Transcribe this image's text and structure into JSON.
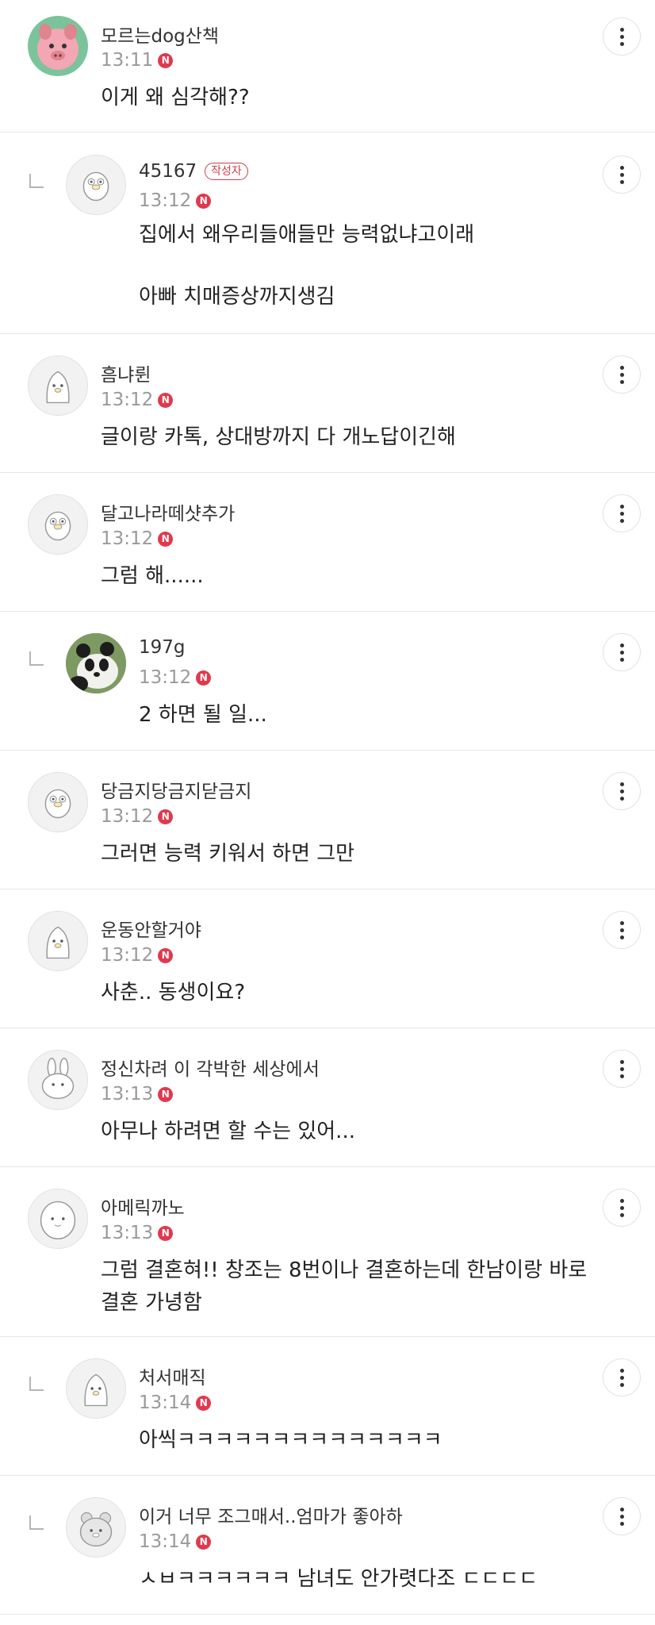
{
  "comments": [
    {
      "nick": "모르는dog산책",
      "time": "13:11",
      "badge": "N",
      "lines": [
        "이게 왜 심각해??"
      ]
    },
    {
      "nick": "45167",
      "author_badge": "작성자",
      "time": "13:12",
      "badge": "N",
      "lines": [
        "집에서 왜우리들애들만 능력없냐고이래",
        "",
        "아빠 치매증상까지생김"
      ]
    },
    {
      "nick": "흠냐륀",
      "time": "13:12",
      "badge": "N",
      "lines": [
        "글이랑 카톡, 상대방까지 다 개노답이긴해"
      ]
    },
    {
      "nick": "달고나라떼샷추가",
      "time": "13:12",
      "badge": "N",
      "lines": [
        "그럼 해......"
      ]
    },
    {
      "nick": "197g",
      "time": "13:12",
      "badge": "N",
      "lines": [
        "2 하면 될 일..."
      ]
    },
    {
      "nick": "당금지당금지닫금지",
      "time": "13:12",
      "badge": "N",
      "lines": [
        "그러면 능력 키워서 하면 그만"
      ]
    },
    {
      "nick": "운동안할거야",
      "time": "13:12",
      "badge": "N",
      "lines": [
        "사춘.. 동생이요?"
      ]
    },
    {
      "nick": "정신차려 이 각박한 세상에서",
      "time": "13:13",
      "badge": "N",
      "lines": [
        "아무나 하려면 할 수는 있어..."
      ]
    },
    {
      "nick": "아메릭까노",
      "time": "13:13",
      "badge": "N",
      "lines": [
        "그럼 결혼혀!! 창조는 8번이나 결혼하는데 한남이랑 바로",
        "결혼 가녕함"
      ]
    },
    {
      "nick": "처서매직",
      "time": "13:14",
      "badge": "N",
      "lines": [
        "아씩ㅋㅋㅋㅋㅋㅋㅋㅋㅋㅋㅋㅋㅋㅋ"
      ]
    },
    {
      "nick": "이거 너무 조그매서..엄마가 좋아하",
      "time": "13:14",
      "badge": "N",
      "lines": [
        "ㅅㅂㅋㅋㅋㅋㅋㅋ 남녀도 안가렷다조 ㄷㄷㄷㄷ"
      ]
    }
  ],
  "colors": {
    "badge": "#e0394e",
    "author_badge": "#d23c4b",
    "divider": "#e6e6e6",
    "time": "#999999"
  }
}
